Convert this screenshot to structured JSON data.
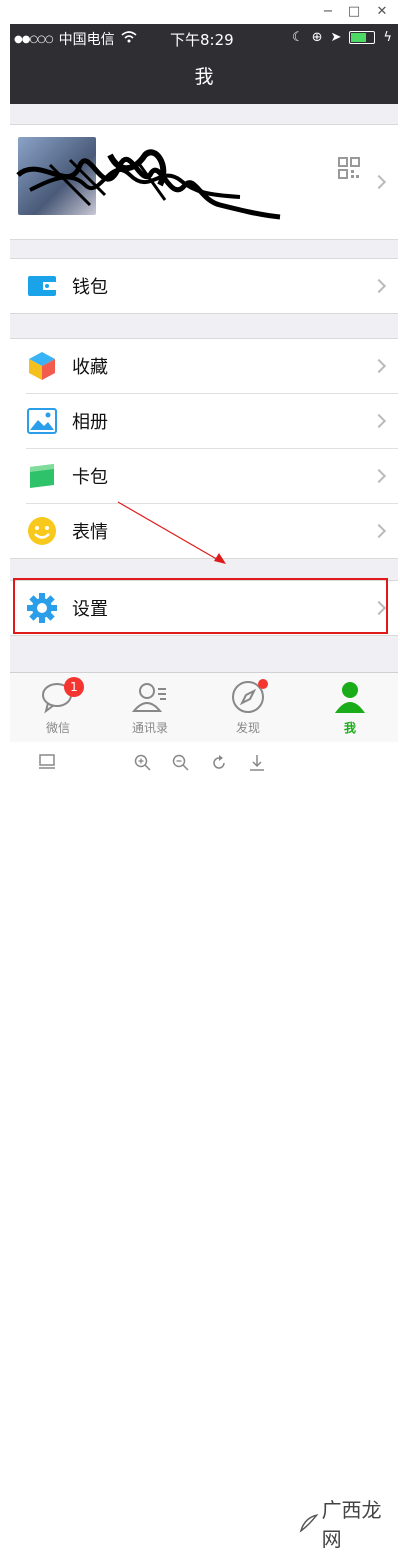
{
  "window": {
    "minimize": "−",
    "maximize": "□",
    "close": "✕"
  },
  "status": {
    "carrier": "中国电信",
    "time": "下午8:29",
    "battery_level": 0.75
  },
  "nav": {
    "title": "我"
  },
  "menu": {
    "wallet": "钱包",
    "favorites": "收藏",
    "album": "相册",
    "cards": "卡包",
    "stickers": "表情",
    "settings": "设置"
  },
  "tabs": [
    {
      "label": "微信",
      "badge": "1"
    },
    {
      "label": "通讯录"
    },
    {
      "label": "发现"
    },
    {
      "label": "我"
    }
  ],
  "colors": {
    "accent": "#1aad19",
    "dark_bar": "#2e2e33",
    "highlight": "#e01a1a",
    "badge": "#f43530"
  },
  "watermark": {
    "text": "广西龙网"
  }
}
